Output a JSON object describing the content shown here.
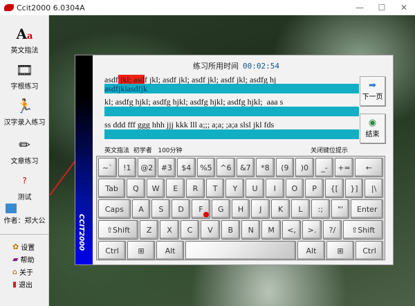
{
  "window": {
    "title": "Ccit2000 6.0304A"
  },
  "sidebar": {
    "items": [
      {
        "label": "英文指法"
      },
      {
        "label": "字根练习"
      },
      {
        "label": "汉字录入练习"
      },
      {
        "label": "文章练习"
      },
      {
        "label": "测试"
      }
    ],
    "author": "作者：郑大公",
    "links": [
      {
        "label": "设置"
      },
      {
        "label": "帮助"
      },
      {
        "label": "关于"
      },
      {
        "label": "退出"
      }
    ]
  },
  "panel": {
    "brand": "CCIT2000",
    "timer_label": "练习所用时间",
    "timer": "00:02:54",
    "lines": [
      {
        "pre": "asdf",
        "error": " jkl; asd",
        "post": "f jkl; asdf jkl; asdf jkl; asdf jkl; asdfg hj",
        "typed": "asdfjklasdfjk"
      },
      {
        "pre": "kl; asdfg hjkl; asdfg hjkl; asdfg hjkl; asdfg hjkl;  aaa s",
        "typed": ""
      },
      {
        "pre": "ss ddd fff ggg hhh jjj kkk lll a;;; a;a; ;a;a slsl jkl fds",
        "typed": ""
      }
    ],
    "next_page": "下一页",
    "finish": "结束",
    "status_mode": "英文指法",
    "status_level": "初学者",
    "status_time": "100分钟",
    "toggle_hint": "关闭键位提示"
  },
  "keyboard": {
    "rows": [
      [
        "~`",
        "!1",
        "@2",
        "#3",
        "$4",
        "%5",
        "^6",
        "&7",
        "*8",
        "(9",
        ")0",
        "_-",
        "+=",
        "←"
      ],
      [
        "Tab",
        "Q",
        "W",
        "E",
        "R",
        "T",
        "Y",
        "U",
        "I",
        "O",
        "P",
        "{[",
        "}]",
        "|\\"
      ],
      [
        "Caps",
        "A",
        "S",
        "D",
        "F",
        "G",
        "H",
        "J",
        "K",
        "L",
        ":;",
        "\"'",
        "Enter"
      ],
      [
        "⇧Shift",
        "Z",
        "X",
        "C",
        "V",
        "B",
        "N",
        "M",
        "<,",
        ">.",
        "?/",
        "⇧Shift"
      ],
      [
        "Ctrl",
        "⊞",
        "Alt",
        " ",
        "Alt",
        "⊞",
        "Ctrl"
      ]
    ],
    "highlight_key": "F",
    "accent": "#e00000"
  }
}
